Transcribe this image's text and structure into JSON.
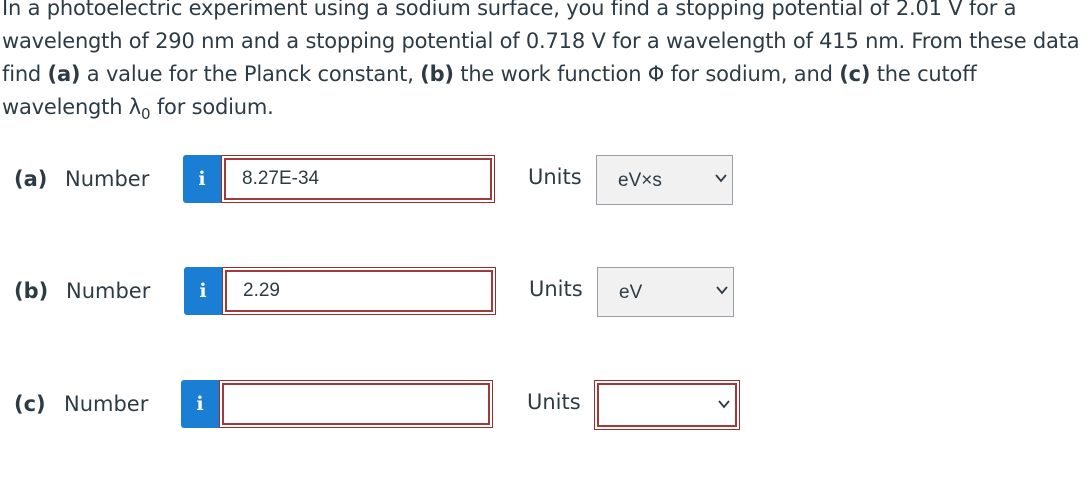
{
  "question": {
    "line1": "In a photoelectric experiment using a sodium surface, you find a stopping potential of 2.01 V for a",
    "line2": "wavelength of 290 nm and a stopping potential of 0.718 V for a wavelength of 415 nm. From these data",
    "line3_a": "find ",
    "line3_b": "(a)",
    "line3_c": " a value for the Planck constant, ",
    "line3_d": "(b)",
    "line3_e": " the work function Φ for sodium, and ",
    "line3_f": "(c)",
    "line3_g": " the cutoff",
    "line4_a": "wavelength λ",
    "line4_sub": "0",
    "line4_b": " for sodium."
  },
  "parts": [
    {
      "label": "(a)",
      "number_label": "Number",
      "info": "i",
      "value": "8.27E-34",
      "units_label": "Units",
      "units_value": "eV×s"
    },
    {
      "label": "(b)",
      "number_label": "Number",
      "info": "i",
      "value": "2.29",
      "units_label": "Units",
      "units_value": "eV"
    },
    {
      "label": "(c)",
      "number_label": "Number",
      "info": "i",
      "value": "",
      "units_label": "Units",
      "units_value": ""
    }
  ]
}
